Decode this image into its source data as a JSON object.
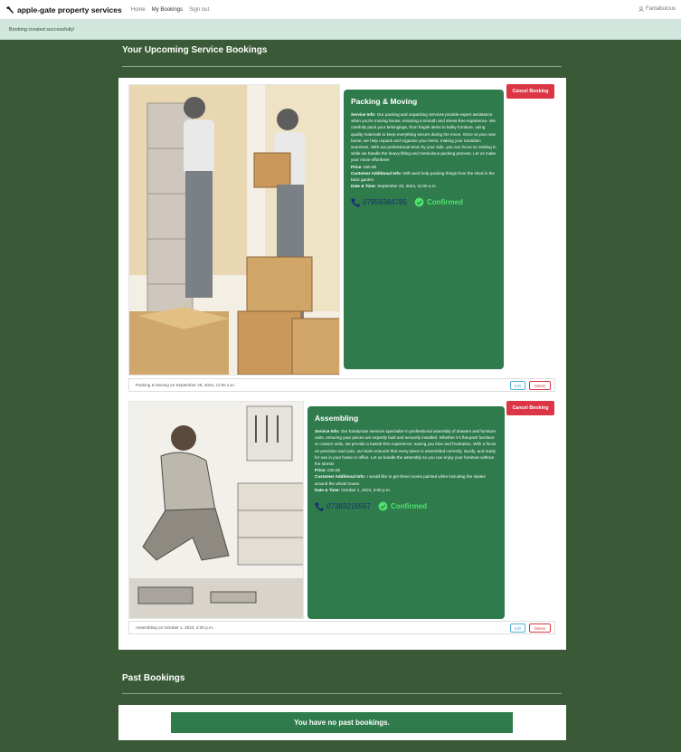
{
  "navbar": {
    "brand": "apple-gate property services",
    "links": [
      "Home",
      "My Bookings",
      "Sign out"
    ],
    "user": "Fantabulous"
  },
  "alert": {
    "message": "Booking created successfully!"
  },
  "upcoming": {
    "title": "Your Upcoming Service Bookings",
    "bookings": [
      {
        "service": "Packing & Moving",
        "service_info_label": "Service Info:",
        "service_info": "Our packing and unpacking services provide expert assistance when you're moving house, ensuring a smooth and stress-free experience. We carefully pack your belongings, from fragile items to bulky furniture, using quality materials to keep everything secure during the move. Once at your new home, we help unpack and organize your items, making your transition seamless. With our professional team by your side, you can focus on settling in while we handle the heavy lifting and meticulous packing process. Let us make your move effortless!",
        "price_label": "Price:",
        "price": "£50.00",
        "additional_label": "Customer Additional Info:",
        "additional": "Will need help packing things from the shed in the back garden",
        "datetime_label": "Date & Time:",
        "datetime": "September 25, 2024, 11:00 a.m.",
        "phone": "07959384785",
        "status": "Confirmed",
        "cancel_label": "Cancel Booking",
        "footer": "Packing & Moving on September 25, 2024, 11:00 a.m.",
        "edit_label": "Edit",
        "delete_label": "Delete"
      },
      {
        "service": "Assembling",
        "service_info_label": "Service Info:",
        "service_info": "Our handyman services specialize in professional assembly of drawers and furniture units, ensuring your pieces are expertly built and securely installed. Whether it's flat-pack furniture or custom units, we provide a hassle-free experience, saving you time and frustration. With a focus on precision and care, our team ensures that every piece is assembled correctly, sturdy, and ready for use in your home or office. Let us handle the assembly so you can enjoy your furniture without the stress!",
        "price_label": "Price:",
        "price": "£40.00",
        "additional_label": "Customer Additional Info:",
        "additional": "I would like to get three rooms painted white including the skates around the whole house.",
        "datetime_label": "Date & Time:",
        "datetime": "October 1, 2024, 3:00 p.m.",
        "phone": "07383216557",
        "status": "Confirmed",
        "cancel_label": "Cancel Booking",
        "footer": "Assembling on October 1, 2024, 3:00 p.m.",
        "edit_label": "Edit",
        "delete_label": "Delete"
      }
    ]
  },
  "past": {
    "title": "Past Bookings",
    "empty_message": "You have no past bookings."
  },
  "colors": {
    "page_bg": "#3a5a37",
    "card_green": "#2f7b4b",
    "cancel_red": "#dc3545",
    "status_green": "#4ee36c",
    "phone_blue": "#1c2a7a"
  }
}
